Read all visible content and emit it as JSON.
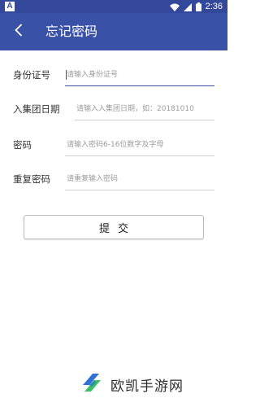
{
  "status_bar": {
    "time": "2:36",
    "notification_badge": "A",
    "icons": [
      "wifi-icon",
      "signal-icon",
      "battery-icon"
    ]
  },
  "app_bar": {
    "back_icon": "chevron-left-icon",
    "title": "忘记密码"
  },
  "form": {
    "id_number": {
      "label": "身份证号",
      "placeholder": "请输入身份证号"
    },
    "join_date": {
      "label": "入集团日期",
      "placeholder": "请输入入集团日期，如：20181010"
    },
    "password": {
      "label": "密码",
      "placeholder": "请输入密码6-16位数字及字母"
    },
    "confirm_password": {
      "label": "重复密码",
      "placeholder": "请重复输入密码"
    }
  },
  "submit_label": "提交",
  "watermark": {
    "text": "欧凯手游网",
    "icon": "logo-icon"
  },
  "colors": {
    "primary": "#3a51a8",
    "status_bar": "#33489a",
    "logo_blue": "#2f6fd6",
    "logo_green": "#3fbf6a"
  }
}
